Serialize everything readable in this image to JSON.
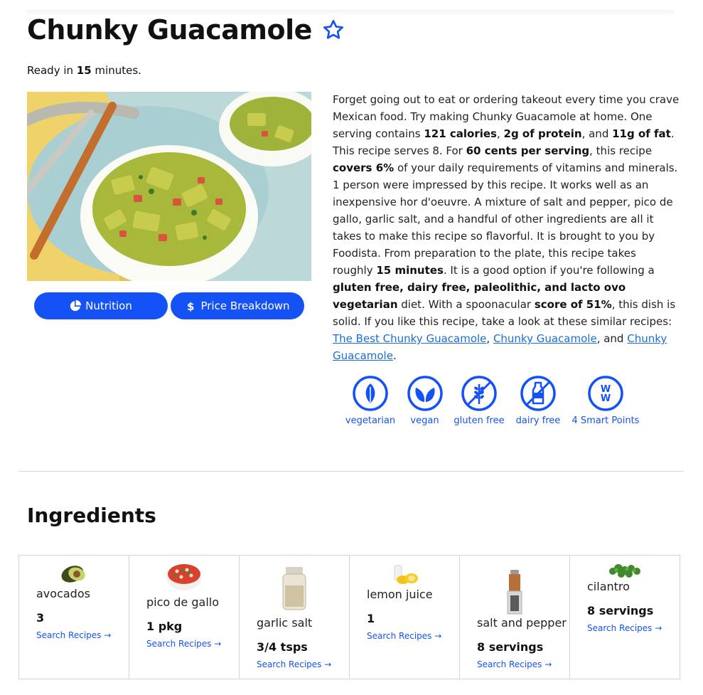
{
  "recipe": {
    "title": "Chunky Guacamole",
    "ready_prefix": "Ready in ",
    "ready_minutes": "15",
    "ready_suffix": " minutes."
  },
  "buttons": {
    "nutrition": "Nutrition",
    "price": "Price Breakdown"
  },
  "description": {
    "p1": "Forget going out to eat or ordering takeout every time you crave Mexican food. Try making Chunky Guacamole at home. One serving contains ",
    "calories": "121 calories",
    "c1": ", ",
    "protein": "2g of protein",
    "c2": ", and ",
    "fat": "11g of fat",
    "p2": ". This recipe serves 8. For ",
    "cost": "60 cents per serving",
    "p3": ", this recipe ",
    "covers": "covers 6%",
    "p4": " of your daily requirements of vitamins and minerals. 1 person were impressed by this recipe. It works well as an inexpensive hor d'oeuvre. A mixture of salt and pepper, pico de gallo, garlic salt, and a handful of other ingredients are all it takes to make this recipe so flavorful. It is brought to you by Foodista. From preparation to the plate, this recipe takes roughly ",
    "minutes": "15 minutes",
    "p5": ". It is a good option if you're following a ",
    "diets": "gluten free, dairy free, paleolithic, and lacto ovo vegetarian",
    "p6": " diet. With a spoonacular ",
    "score": "score of 51%",
    "p7": ", this dish is solid. If you like this recipe, take a look at these similar recipes: ",
    "link1": "The Best Chunky Guacamole",
    "c3": ", ",
    "link2": "Chunky Guacamole",
    "c4": ", and ",
    "link3": "Chunky Guacamole",
    "end": "."
  },
  "badges": [
    {
      "label": "vegetarian",
      "icon": "leaf-icon"
    },
    {
      "label": "vegan",
      "icon": "double-leaf-icon"
    },
    {
      "label": "gluten free",
      "icon": "wheat-crossed-icon"
    },
    {
      "label": "dairy free",
      "icon": "milk-crossed-icon"
    },
    {
      "label": "4 Smart Points",
      "icon": "ww-icon"
    }
  ],
  "ingredients_title": "Ingredients",
  "ingredients": [
    {
      "name": "avocados",
      "amount": "3",
      "link": "Search Recipes →"
    },
    {
      "name": "pico de gallo",
      "amount": "1 pkg",
      "link": "Search Recipes →"
    },
    {
      "name": "garlic salt",
      "amount": "3/4 tsps",
      "link": "Search Recipes →"
    },
    {
      "name": "lemon juice",
      "amount": "1",
      "link": "Search Recipes →"
    },
    {
      "name": "salt and pepper",
      "amount": "8 servings",
      "link": "Search Recipes →"
    },
    {
      "name": "cilantro",
      "amount": "8 servings",
      "link": "Search Recipes →"
    }
  ],
  "colors": {
    "accent": "#1452f5",
    "link": "#1a6ed8"
  }
}
